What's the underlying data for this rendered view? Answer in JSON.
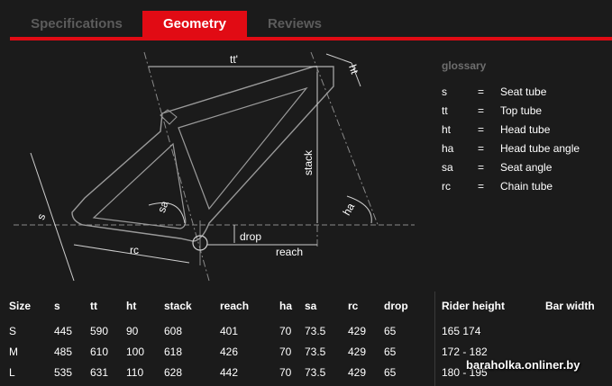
{
  "tabs": [
    {
      "label": "Specifications",
      "active": false
    },
    {
      "label": "Geometry",
      "active": true
    },
    {
      "label": "Reviews",
      "active": false
    }
  ],
  "diagram": {
    "labels": {
      "tt": "tt'",
      "ht": "ht",
      "stack": "stack",
      "s": "s",
      "sa": "sa",
      "ha": "ha",
      "rc": "rc",
      "drop": "drop",
      "reach": "reach"
    }
  },
  "glossary": {
    "title": "glossary",
    "items": [
      {
        "sym": "s",
        "eq": "=",
        "def": "Seat tube"
      },
      {
        "sym": "tt",
        "eq": "=",
        "def": "Top tube"
      },
      {
        "sym": "ht",
        "eq": "=",
        "def": "Head tube"
      },
      {
        "sym": "ha",
        "eq": "=",
        "def": "Head tube angle"
      },
      {
        "sym": "sa",
        "eq": "=",
        "def": "Seat angle"
      },
      {
        "sym": "rc",
        "eq": "=",
        "def": "Chain tube"
      }
    ]
  },
  "table": {
    "headers": [
      "Size",
      "s",
      "tt",
      "ht",
      "stack",
      "reach",
      "ha",
      "sa",
      "rc",
      "drop"
    ],
    "rider_headers": [
      "Rider height",
      "Bar width"
    ],
    "rows": [
      {
        "cells": [
          "S",
          "445",
          "590",
          "90",
          "608",
          "401",
          "70",
          "73.5",
          "429",
          "65"
        ],
        "rider": "165 174",
        "bar": ""
      },
      {
        "cells": [
          "M",
          "485",
          "610",
          "100",
          "618",
          "426",
          "70",
          "73.5",
          "429",
          "65"
        ],
        "rider": "172 - 182",
        "bar": ""
      },
      {
        "cells": [
          "L",
          "535",
          "631",
          "110",
          "628",
          "442",
          "70",
          "73.5",
          "429",
          "65"
        ],
        "rider": "180 - 195",
        "bar": ""
      }
    ]
  },
  "watermark": "baraholka.onliner.by",
  "colors": {
    "accent": "#e10b14",
    "background": "#1b1b1b",
    "inactive_tab": "#5c5c5c",
    "frame_line": "#8a8a8a"
  }
}
